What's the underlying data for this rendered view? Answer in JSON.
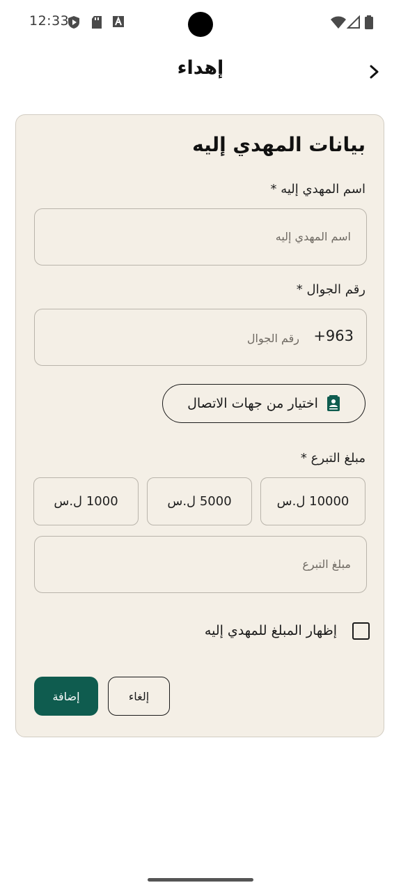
{
  "status_bar": {
    "time": "12:33"
  },
  "app_bar": {
    "title": "إهداء",
    "back_icon": "chevron-right-icon"
  },
  "form": {
    "section_title": "بيانات المهدي إليه",
    "recipient_name": {
      "label": "اسم المهدي إليه *",
      "placeholder": "اسم المهدي إليه",
      "value": ""
    },
    "phone": {
      "label": "رقم الجوال *",
      "country_code": "+963",
      "placeholder": "رقم الجوال",
      "value": ""
    },
    "contacts_button": {
      "label": "اختيار من جهات الاتصال",
      "icon": "contact-book-icon"
    },
    "amount": {
      "label": "مبلغ التبرع *",
      "presets": [
        "10000 ل.س",
        "5000 ل.س",
        "1000 ل.س"
      ],
      "placeholder": "مبلغ التبرع",
      "value": ""
    },
    "show_amount": {
      "label": "إظهار المبلغ للمهدي إليه",
      "checked": false
    },
    "cancel_label": "إلغاء",
    "add_label": "إضافة"
  },
  "colors": {
    "card_background": "#f4efe6",
    "primary": "#0f5c4f"
  }
}
